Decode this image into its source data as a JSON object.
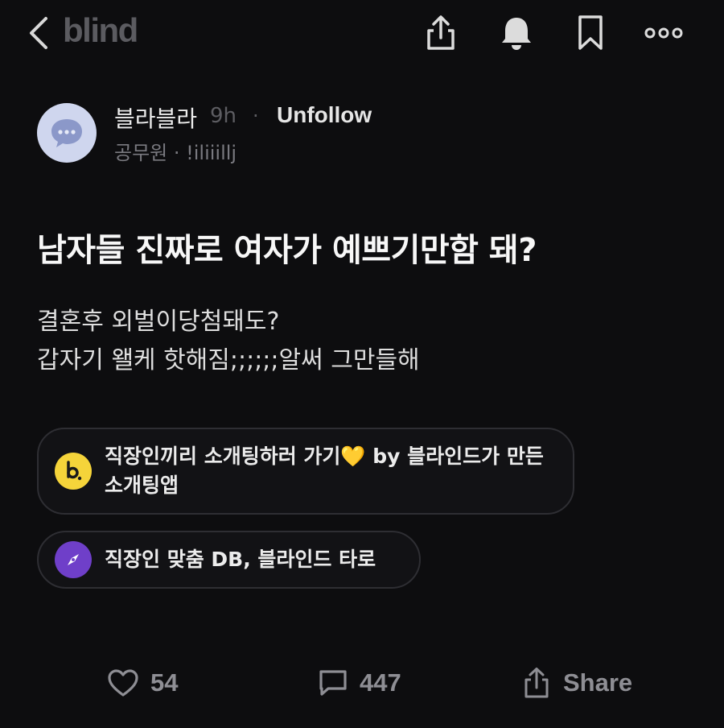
{
  "header": {
    "logo": "blind",
    "icons": [
      "back-icon",
      "share-icon",
      "bell-icon",
      "bookmark-icon",
      "more-icon"
    ]
  },
  "author": {
    "name": "블라블라",
    "time": "9h",
    "separator": "·",
    "follow_label": "Unfollow",
    "meta": "공무원 · !iliiillj"
  },
  "post": {
    "title": "남자들 진짜로 여자가 예쁘기만함 돼?",
    "body_lines": [
      "결혼후 외벌이당첨돼도?",
      "갑자기 왤케 핫해짐;;;;;;알써 그만들해"
    ]
  },
  "promos": [
    {
      "icon": "blind-dating-logo-icon",
      "text": "직장인끼리 소개팅하러 가기💛 by 블라인드가 만든 소개팅앱",
      "icon_color": "#f5d43a"
    },
    {
      "icon": "compass-icon",
      "text": "직장인 맞춤 DB, 블라인드 타로",
      "icon_color": "#6f3fc9"
    }
  ],
  "actions": {
    "likes": "54",
    "comments": "447",
    "share_label": "Share"
  },
  "colors": {
    "background": "#0d0d0f",
    "logo": "#5b5b60",
    "muted": "#8e8e94",
    "avatar": "#cfd6ee"
  }
}
